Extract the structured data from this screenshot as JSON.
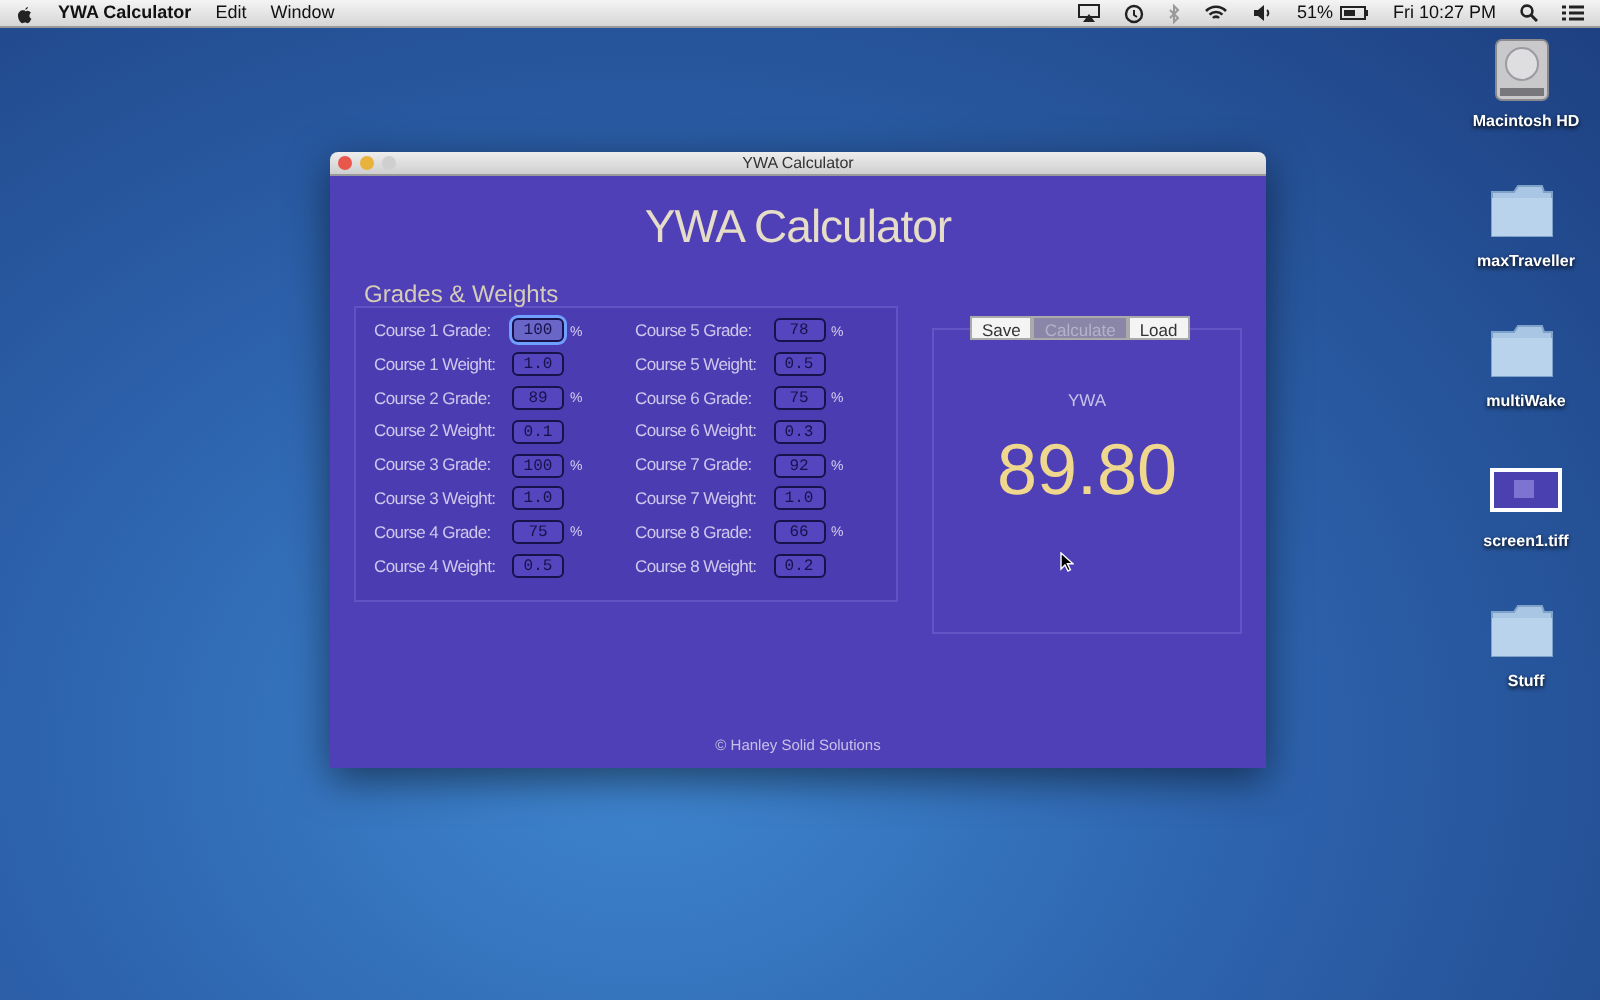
{
  "menu_bar": {
    "app_name": "YWA Calculator",
    "menus": [
      "Edit",
      "Window"
    ],
    "battery": "51%",
    "clock": "Fri 10:27 PM"
  },
  "window": {
    "title": "YWA Calculator",
    "heading": "YWA Calculator",
    "grades_title": "Grades & Weights",
    "columns": [
      {
        "fields": [
          {
            "label": "Course 1 Grade:",
            "value": "100",
            "unit": "%",
            "focused": true
          },
          {
            "label": "Course 1 Weight:",
            "value": "1.0",
            "focused": false
          },
          {
            "label": "Course 2 Grade:",
            "value": "89",
            "unit": "%",
            "focused": false
          },
          {
            "label": "Course 2 Weight:",
            "value": "0.1",
            "focused": false
          },
          {
            "label": "Course 3 Grade:",
            "value": "100",
            "unit": "%",
            "focused": false
          },
          {
            "label": "Course 3 Weight:",
            "value": "1.0",
            "focused": false
          },
          {
            "label": "Course 4 Grade:",
            "value": "75",
            "unit": "%",
            "focused": false
          },
          {
            "label": "Course 4 Weight:",
            "value": "0.5",
            "focused": false
          }
        ]
      },
      {
        "fields": [
          {
            "label": "Course 5 Grade:",
            "value": "78",
            "unit": "%",
            "focused": false
          },
          {
            "label": "Course 5 Weight:",
            "value": "0.5",
            "focused": false
          },
          {
            "label": "Course 6 Grade:",
            "value": "75",
            "unit": "%",
            "focused": false
          },
          {
            "label": "Course 6 Weight:",
            "value": "0.3",
            "focused": false
          },
          {
            "label": "Course 7 Grade:",
            "value": "92",
            "unit": "%",
            "focused": false
          },
          {
            "label": "Course 7 Weight:",
            "value": "1.0",
            "focused": false
          },
          {
            "label": "Course 8 Grade:",
            "value": "66",
            "unit": "%",
            "focused": false
          },
          {
            "label": "Course 8 Weight:",
            "value": "0.2",
            "focused": false
          }
        ]
      }
    ],
    "actions": [
      {
        "label": "Save",
        "selected": false
      },
      {
        "label": "Calculate",
        "selected": true
      },
      {
        "label": "Load",
        "selected": false
      }
    ],
    "result_label": "YWA",
    "result_value": "89.80",
    "footer": "© Hanley Solid Solutions"
  },
  "desktop_icons": [
    {
      "label": "Macintosh HD",
      "kind": "drive"
    },
    {
      "label": "maxTraveller",
      "kind": "folder"
    },
    {
      "label": "multiWake",
      "kind": "folder"
    },
    {
      "label": "screen1.tiff",
      "kind": "image"
    },
    {
      "label": "Stuff",
      "kind": "folder"
    }
  ]
}
